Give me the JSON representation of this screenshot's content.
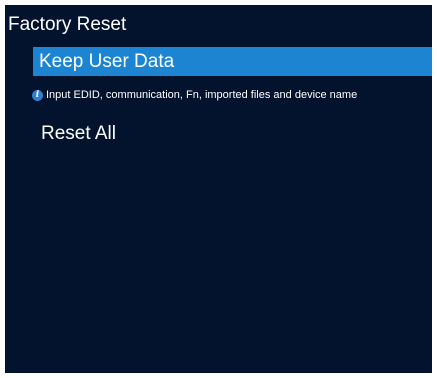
{
  "menu": {
    "title": "Factory Reset",
    "items": [
      {
        "label": "Keep User Data",
        "selected": true
      },
      {
        "label": "Reset All",
        "selected": false
      }
    ],
    "hint": {
      "icon": "info-icon",
      "text": "Input EDID, communication, Fn, imported files and device name"
    }
  },
  "colors": {
    "background": "#03132e",
    "selection": "#1c84d0",
    "text": "#ffffff",
    "info_icon": "#2e7fd6"
  }
}
